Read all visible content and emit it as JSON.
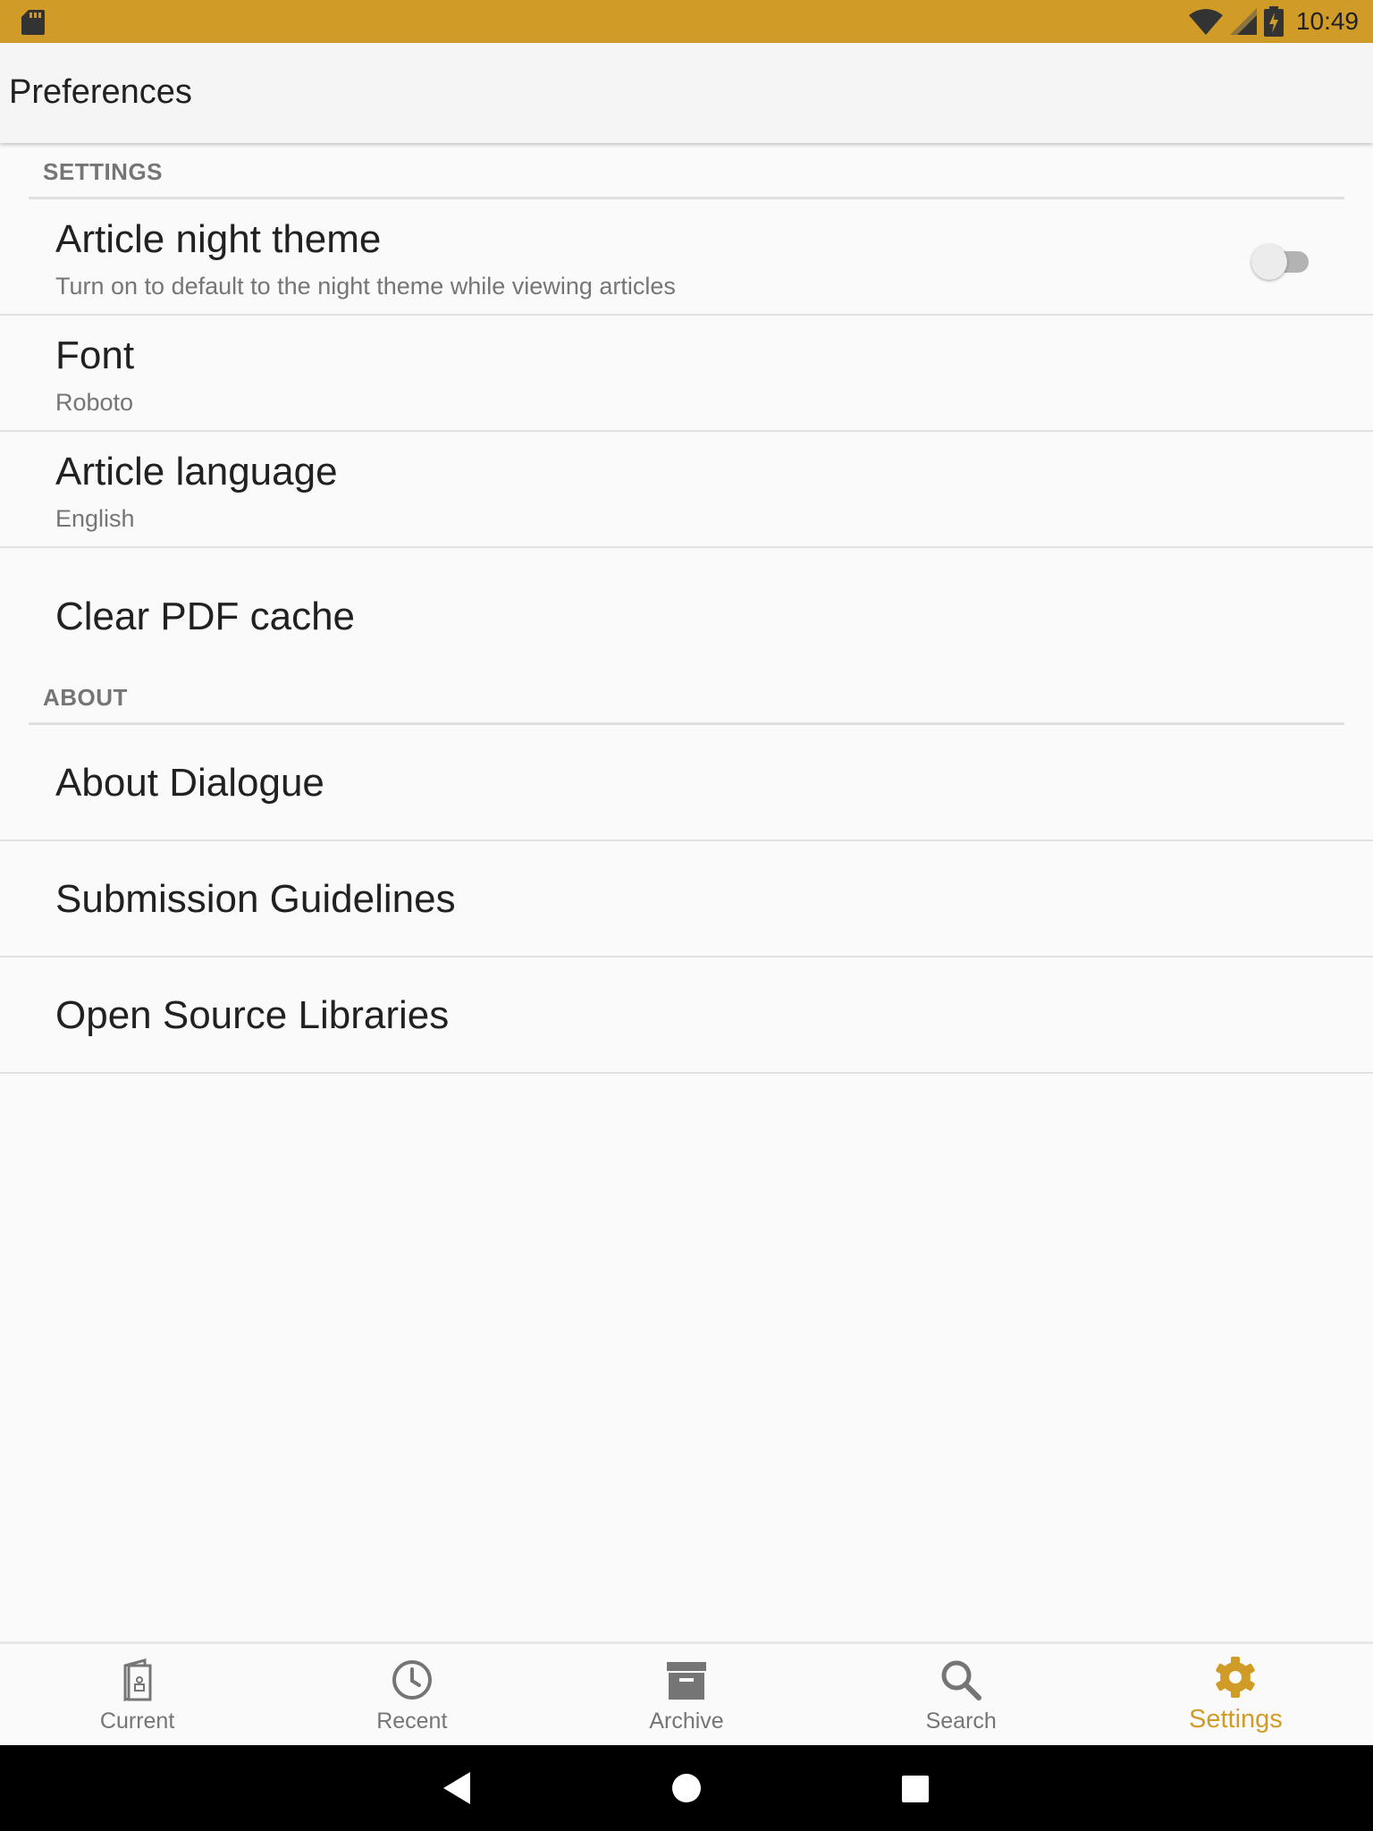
{
  "status_bar": {
    "time": "10:49",
    "color": "#d09c27"
  },
  "app_bar": {
    "title": "Preferences"
  },
  "sections": {
    "settings": {
      "header": "SETTINGS",
      "items": [
        {
          "title": "Article night theme",
          "subtitle": "Turn on to default to the night theme while viewing articles",
          "toggle": "off"
        },
        {
          "title": "Font",
          "subtitle": "Roboto"
        },
        {
          "title": "Article language",
          "subtitle": "English"
        },
        {
          "title": "Clear PDF cache"
        }
      ]
    },
    "about": {
      "header": "ABOUT",
      "items": [
        {
          "title": "About Dialogue"
        },
        {
          "title": "Submission Guidelines"
        },
        {
          "title": "Open Source Libraries"
        }
      ]
    }
  },
  "bottom_nav": {
    "items": [
      {
        "label": "Current",
        "icon": "newspaper-icon"
      },
      {
        "label": "Recent",
        "icon": "clock-icon"
      },
      {
        "label": "Archive",
        "icon": "archive-box-icon"
      },
      {
        "label": "Search",
        "icon": "search-icon"
      },
      {
        "label": "Settings",
        "icon": "gear-icon",
        "active": true
      }
    ],
    "active_color": "#d09c27"
  },
  "system_nav": {
    "buttons": [
      "back-icon",
      "home-icon",
      "recents-icon"
    ]
  }
}
